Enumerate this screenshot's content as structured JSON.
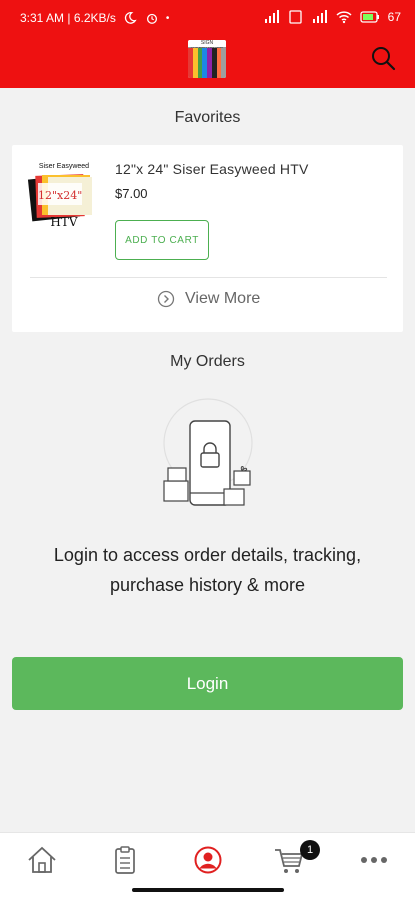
{
  "status_bar": {
    "time_info": "3:31 AM | 6.2KB/s",
    "battery": "67"
  },
  "header": {
    "logo_text": "SIGN WAREHOUSE",
    "search_icon": "search-icon"
  },
  "favorites": {
    "title": "Favorites",
    "product": {
      "name": "12\"x 24\" Siser Easyweed HTV",
      "price": "$7.00",
      "add_to_cart": "ADD TO CART",
      "thumb_brand": "Siser Easyweed",
      "thumb_size": "12\"x24\"",
      "thumb_type": "HTV"
    },
    "view_more": "View More"
  },
  "orders": {
    "title": "My Orders",
    "message": "Login to access order details, tracking, purchase history & more",
    "login_button": "Login"
  },
  "bottom_nav": {
    "items": [
      "home-icon",
      "clipboard-icon",
      "account-icon",
      "cart-icon",
      "more-icon"
    ],
    "cart_count": "1",
    "active": "account-icon"
  },
  "colors": {
    "brand_red": "#ee1111",
    "green": "#5cb85c",
    "outline_green": "#4caf50",
    "active_nav": "#e02020"
  }
}
